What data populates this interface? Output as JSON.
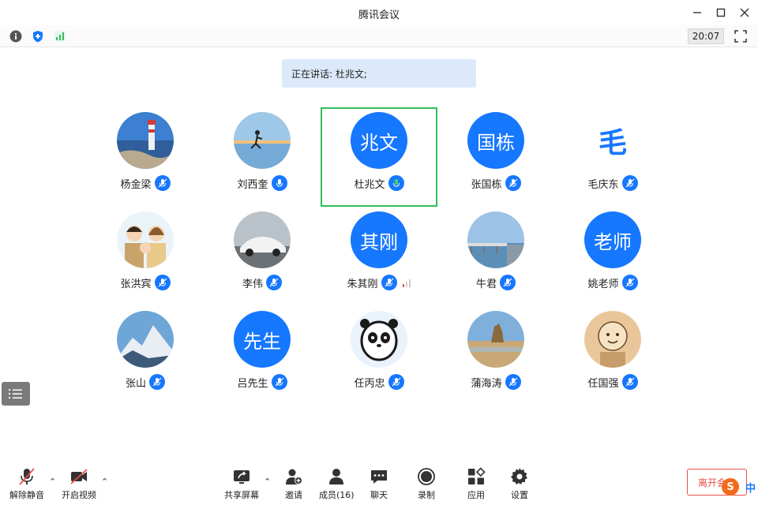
{
  "window": {
    "title": "腾讯会议"
  },
  "infobar": {
    "time": "20:07"
  },
  "speaking": {
    "text": "正在讲话: 杜兆文;"
  },
  "participants": [
    {
      "name": "杨金梁",
      "avatar_type": "photo-lighthouse"
    },
    {
      "name": "刘西奎",
      "avatar_type": "photo-runner-sunset"
    },
    {
      "name": "杜兆文",
      "avatar_type": "text",
      "avatar_text": "兆文",
      "speaking": true
    },
    {
      "name": "张国栋",
      "avatar_type": "text",
      "avatar_text": "国栋"
    },
    {
      "name": "毛庆东",
      "avatar_type": "glyph",
      "avatar_text": "毛"
    },
    {
      "name": "张洪宾",
      "avatar_type": "photo-cartoon-family"
    },
    {
      "name": "李伟",
      "avatar_type": "photo-car"
    },
    {
      "name": "朱其刚",
      "avatar_type": "text",
      "avatar_text": "其刚"
    },
    {
      "name": "牛君",
      "avatar_type": "photo-pier"
    },
    {
      "name": "姚老师",
      "avatar_type": "text",
      "avatar_text": "老师"
    },
    {
      "name": "张山",
      "avatar_type": "photo-mountain"
    },
    {
      "name": "吕先生",
      "avatar_type": "text",
      "avatar_text": "先生"
    },
    {
      "name": "任丙忠",
      "avatar_type": "photo-panda"
    },
    {
      "name": "蒲海涛",
      "avatar_type": "photo-beach-rocks"
    },
    {
      "name": "任国强",
      "avatar_type": "photo-sketch-face"
    }
  ],
  "toolbar": {
    "unmute": "解除静音",
    "start_video": "开启视频",
    "share_screen": "共享屏幕",
    "invite": "邀请",
    "members": "成员(16)",
    "chat": "聊天",
    "record": "录制",
    "apps": "应用",
    "settings": "设置",
    "leave": "离开会议"
  },
  "ime": {
    "logo": "S",
    "mode": "中"
  },
  "colors": {
    "accent": "#1677ff",
    "active_border": "#2fbd5a",
    "leave": "#e8504c"
  }
}
